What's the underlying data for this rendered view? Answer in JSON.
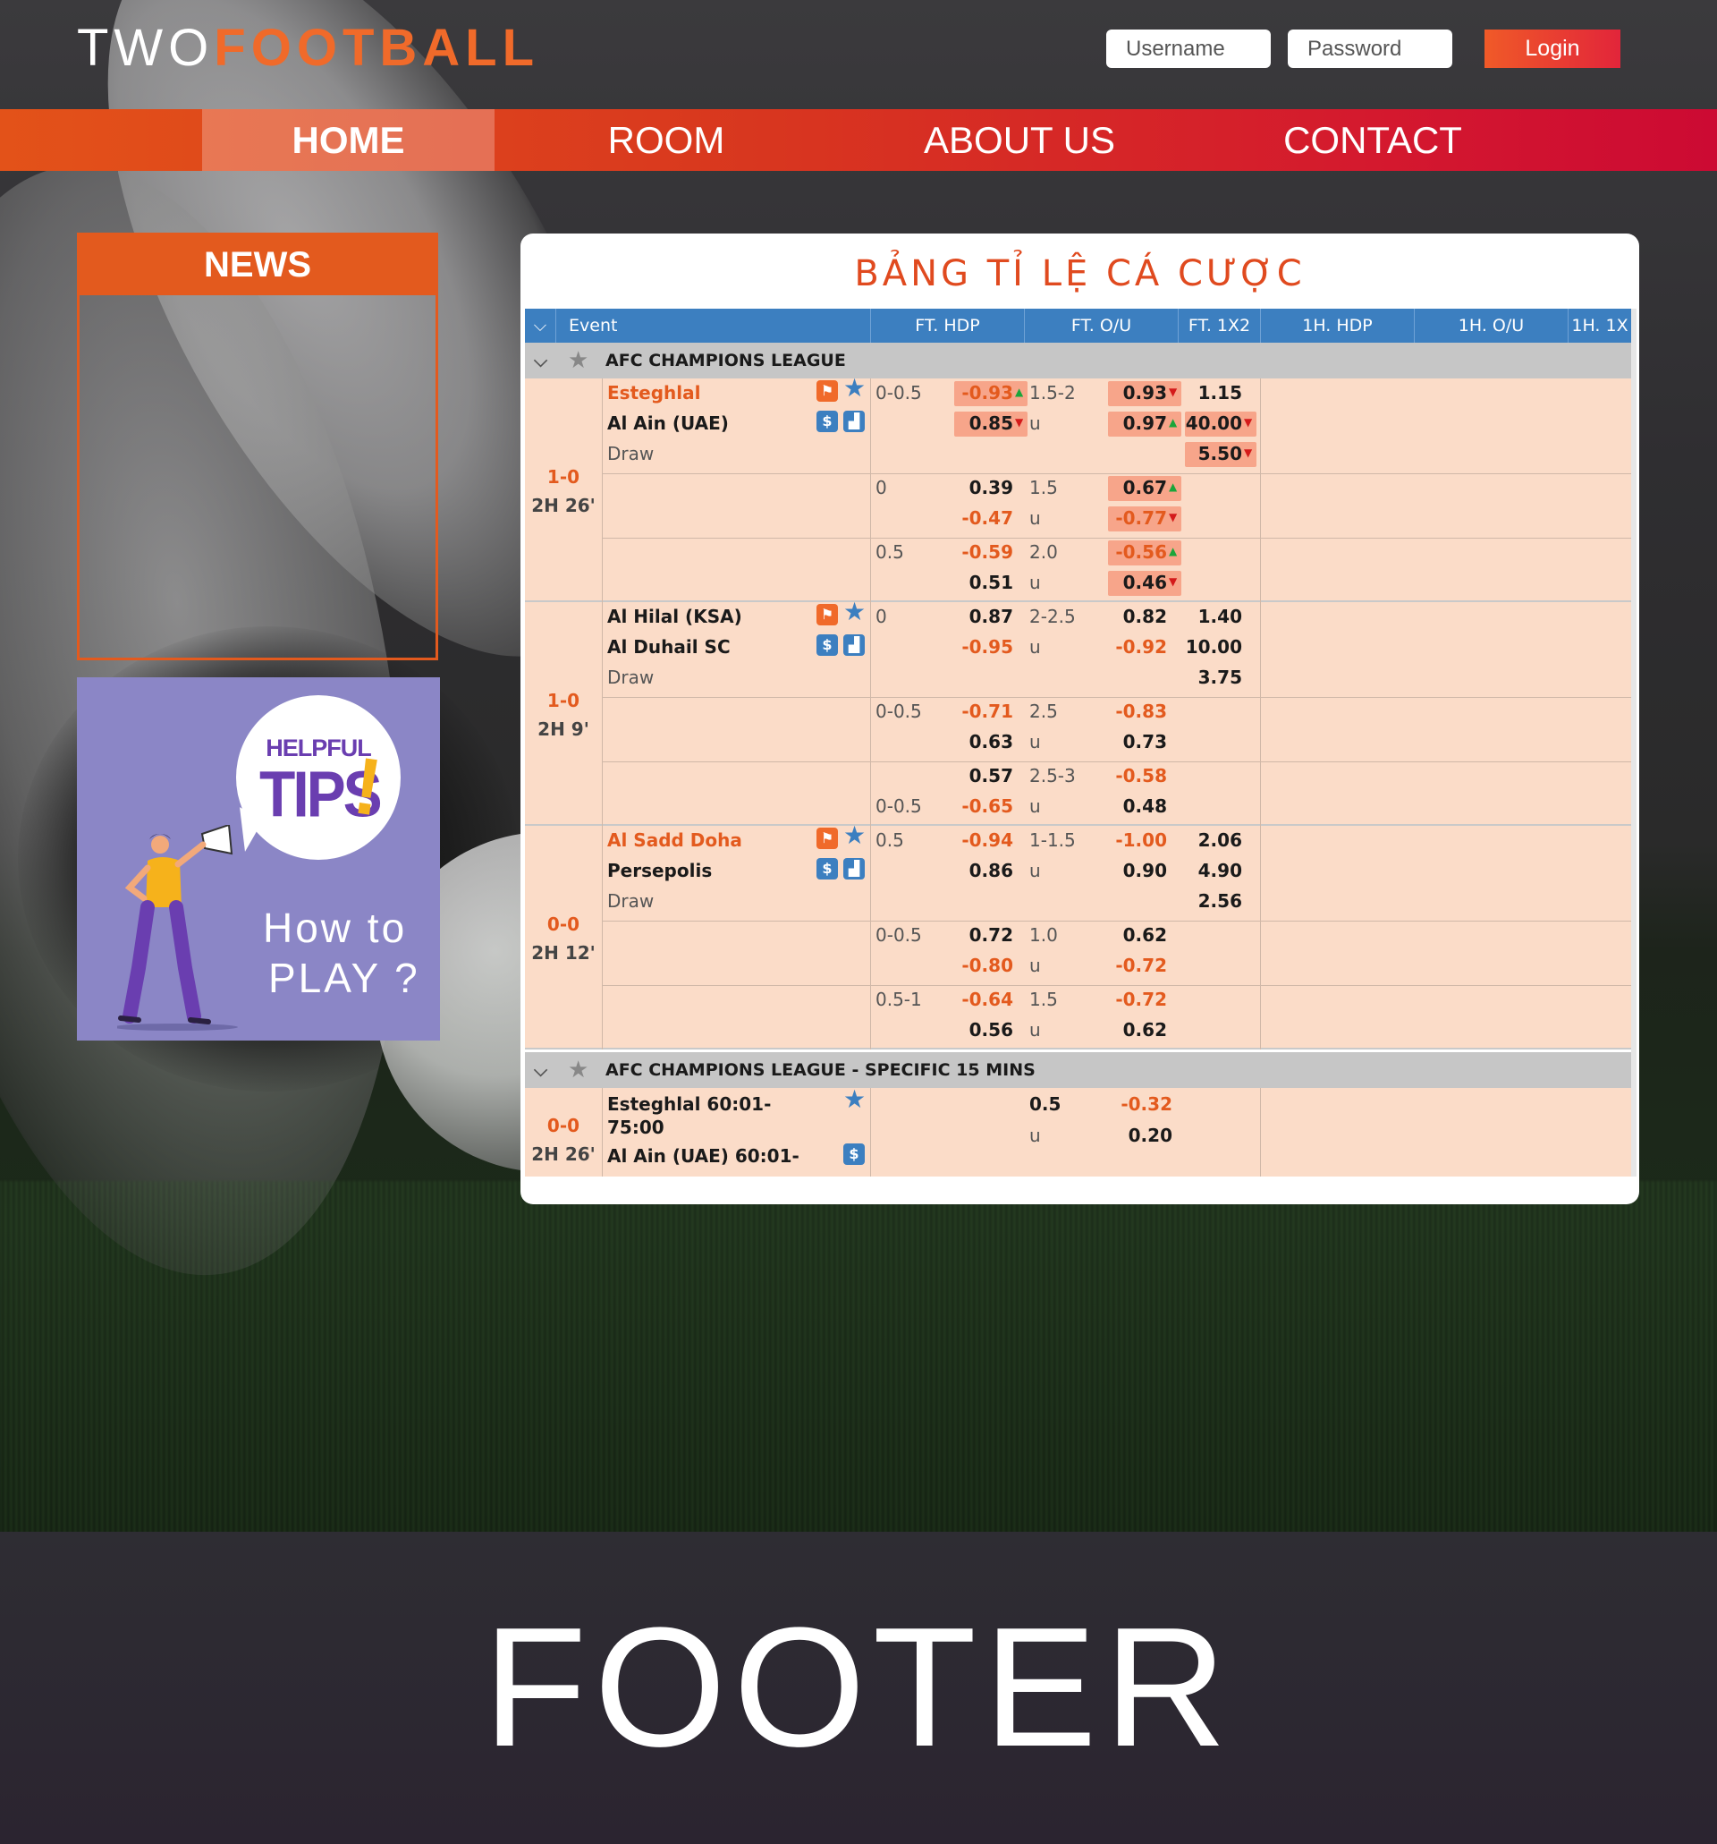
{
  "brand": {
    "part1": "TWO",
    "part2": "FOOTBALL"
  },
  "login": {
    "username_placeholder": "Username",
    "password_placeholder": "Password",
    "button": "Login"
  },
  "nav": [
    {
      "label": "HOME",
      "active": true
    },
    {
      "label": "ROOM",
      "active": false
    },
    {
      "label": "ABOUT US",
      "active": false
    },
    {
      "label": "CONTACT",
      "active": false
    }
  ],
  "news": {
    "title": "NEWS"
  },
  "tips": {
    "helpful": "HELPFUL",
    "tips": "TIPS",
    "excl": "!",
    "howto_line1": "How to",
    "howto_line2": "PLAY ?"
  },
  "odds": {
    "title": "BẢNG TỈ LỆ CÁ CƯỢC",
    "headers": [
      "Event",
      "FT. HDP",
      "FT. O/U",
      "FT. 1X2",
      "1H. HDP",
      "1H. O/U",
      "1H. 1X"
    ],
    "league1": "AFC CHAMPIONS LEAGUE",
    "league2": "AFC CHAMPIONS LEAGUE - SPECIFIC 15 MINS",
    "matches": [
      {
        "score": "1-0",
        "time": "2H 26'",
        "home": "Esteghlal",
        "away": "Al Ain (UAE)",
        "draw": "Draw",
        "rows": [
          {
            "hdp": "0-0.5",
            "h1": "-0.93",
            "h2": "0.85",
            "ou": "1.5-2",
            "u": "u",
            "o1": "0.93",
            "o2": "0.97",
            "x1": "1.15",
            "x2": "40.00",
            "x3": "5.50"
          },
          {
            "hdp": "0",
            "h1": "0.39",
            "h2": "-0.47",
            "ou": "1.5",
            "u": "u",
            "o1": "0.67",
            "o2": "-0.77"
          },
          {
            "hdp": "0.5",
            "h1": "-0.59",
            "h2": "0.51",
            "ou": "2.0",
            "u": "u",
            "o1": "-0.56",
            "o2": "0.46"
          }
        ]
      },
      {
        "score": "1-0",
        "time": "2H 9'",
        "home": "Al Hilal (KSA)",
        "away": "Al Duhail SC",
        "draw": "Draw",
        "rows": [
          {
            "hdp": "0",
            "h1": "0.87",
            "h2": "-0.95",
            "ou": "2-2.5",
            "u": "u",
            "o1": "0.82",
            "o2": "-0.92",
            "x1": "1.40",
            "x2": "10.00",
            "x3": "3.75"
          },
          {
            "hdp": "0-0.5",
            "h1": "-0.71",
            "h2": "0.63",
            "ou": "2.5",
            "u": "u",
            "o1": "-0.83",
            "o2": "0.73"
          },
          {
            "hdp": "0-0.5",
            "h1": "0.57",
            "h2": "-0.65",
            "ou": "2.5-3",
            "u": "u",
            "o1": "-0.58",
            "o2": "0.48"
          }
        ]
      },
      {
        "score": "0-0",
        "time": "2H 12'",
        "home": "Al Sadd Doha",
        "away": "Persepolis",
        "draw": "Draw",
        "rows": [
          {
            "hdp": "0.5",
            "h1": "-0.94",
            "h2": "0.86",
            "ou": "1-1.5",
            "u": "u",
            "o1": "-1.00",
            "o2": "0.90",
            "x1": "2.06",
            "x2": "4.90",
            "x3": "2.56"
          },
          {
            "hdp": "0-0.5",
            "h1": "0.72",
            "h2": "-0.80",
            "ou": "1.0",
            "u": "u",
            "o1": "0.62",
            "o2": "-0.72"
          },
          {
            "hdp": "0.5-1",
            "h1": "-0.64",
            "h2": "0.56",
            "ou": "1.5",
            "u": "u",
            "o1": "-0.72",
            "o2": "0.62"
          }
        ]
      }
    ],
    "special": {
      "score": "0-0",
      "time": "2H 26'",
      "home_line1": "Esteghlal 60:01-",
      "home_line2": "75:00",
      "away_line1": "Al Ain (UAE) 60:01-",
      "ou": "0.5",
      "u": "u",
      "o1": "-0.32",
      "o2": "0.20"
    }
  },
  "footer": {
    "text": "FOOTER"
  },
  "colors": {
    "brand_orange": "#f06a2a",
    "nav_red": "#cc0a33",
    "table_blue": "#3c7fc0",
    "row_peach": "#fbdcc8"
  }
}
